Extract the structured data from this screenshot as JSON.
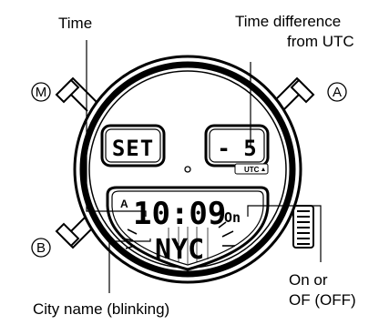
{
  "labels": {
    "time": "Time",
    "utc_line1": "Time difference",
    "utc_line2": "from UTC",
    "onoff_line1": "On or",
    "onoff_line2": "OF (OFF)",
    "city": "City name (blinking)"
  },
  "buttons": {
    "m": "M",
    "a": "A",
    "b": "B"
  },
  "watch": {
    "left_display": "SET",
    "right_display": "- 5",
    "utc_badge": "UTC",
    "main_marker": "A",
    "time": "10:09",
    "onoff_value": "On",
    "city": "NYC"
  },
  "colors": {
    "ink": "#000000",
    "paper": "#ffffff"
  }
}
